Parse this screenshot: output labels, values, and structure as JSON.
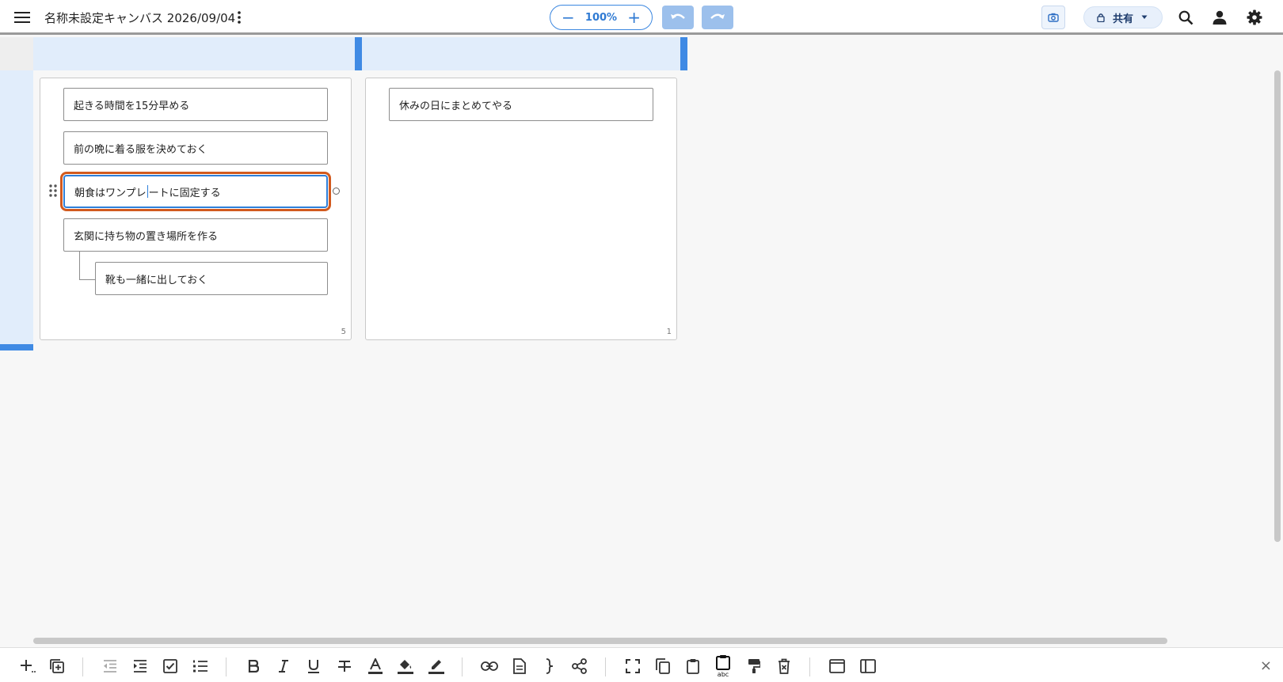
{
  "header": {
    "title": "名称未設定キャンバス 2026/09/04",
    "zoom": {
      "minus": "−",
      "value": "100%",
      "plus": "+"
    },
    "share_label": "共有"
  },
  "panels": [
    {
      "count": "5",
      "cards": [
        {
          "text": "起きる時間を15分早める"
        },
        {
          "text": "前の晩に着る服を決めておく"
        },
        {
          "text_before_caret": "朝食はワンプレ",
          "text_after_caret": "ートに固定する",
          "selected": true
        },
        {
          "text": "玄関に持ち物の置き場所を作る"
        },
        {
          "text": "靴も一緒に出しておく",
          "indent": 1
        }
      ]
    },
    {
      "count": "1",
      "cards": [
        {
          "text": "休みの日にまとめてやる"
        }
      ]
    }
  ],
  "toolbar": {
    "close": "×",
    "clipboard_text": "abc"
  },
  "colors": {
    "accent": "#2e7fd9",
    "selection_outline": "#d25a1e",
    "undo_bg": "#9cc0ec",
    "band": "#e1edfb"
  }
}
